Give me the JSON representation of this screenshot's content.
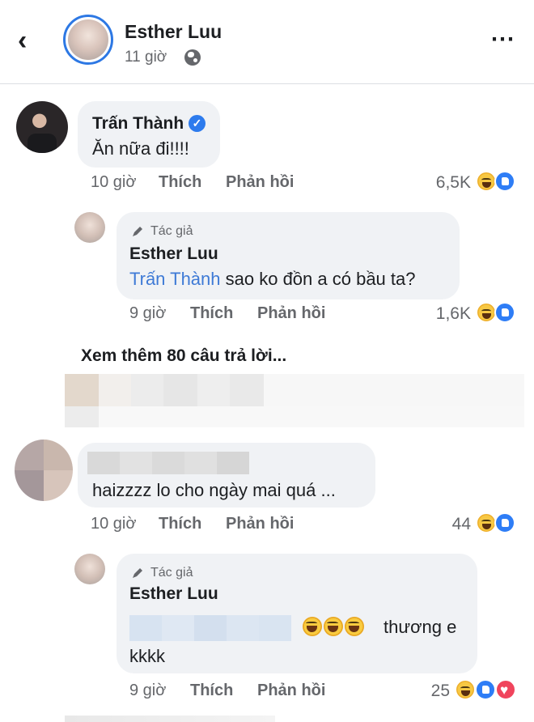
{
  "header": {
    "back_icon": "chevron-left-icon",
    "page_name": "Esther Luu",
    "time": "11 giờ",
    "audience_icon": "globe-icon",
    "more_icon": "more-horizontal-icon"
  },
  "actions": {
    "like_label": "Thích",
    "reply_label": "Phản hồi"
  },
  "comments": [
    {
      "author": "Trấn Thành",
      "verified": true,
      "text": "Ăn nữa đi!!!!",
      "time": "10 giờ",
      "reaction_count": "6,5K",
      "reactions": [
        "haha",
        "like"
      ]
    },
    {
      "badge": "Tác giả",
      "author": "Esther Luu",
      "mention": "Trấn Thành",
      "text": "sao ko đồn a có bầu ta?",
      "time": "9 giờ",
      "reaction_count": "1,6K",
      "reactions": [
        "haha",
        "like"
      ]
    },
    {
      "author": "",
      "text": "haizzzz lo cho ngày mai quá ...",
      "time": "10 giờ",
      "reaction_count": "44",
      "reactions": [
        "haha",
        "like"
      ]
    },
    {
      "badge": "Tác giả",
      "author": "Esther Luu",
      "text_after_emojis": "thương e",
      "text_line2": "kkkk",
      "time": "9 giờ",
      "reaction_count": "25",
      "reactions": [
        "haha",
        "like",
        "love"
      ]
    }
  ],
  "see_more": "Xem thêm 80 câu trả lời...",
  "colors": {
    "accent": "#2d78e4",
    "mention": "#3e7ad6",
    "bubble": "#f0f2f5",
    "secondary_text": "#65676b"
  }
}
